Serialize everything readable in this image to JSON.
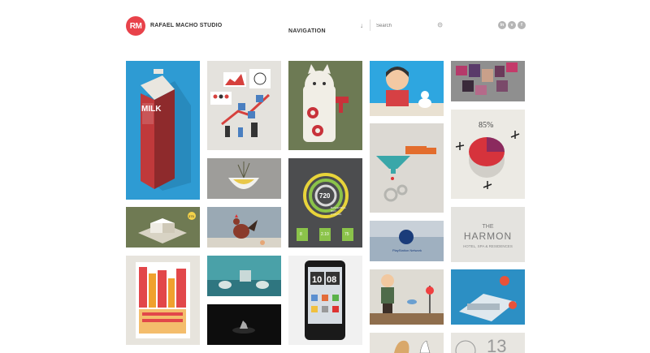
{
  "header": {
    "logo_text": "RM",
    "brand": "RAFAEL MACHO STUDIO",
    "nav_label": "NAVIGATION",
    "search_placeholder": "Search",
    "social": [
      {
        "name": "linkedin-icon",
        "glyph": "in"
      },
      {
        "name": "vimeo-icon",
        "glyph": "v"
      },
      {
        "name": "facebook-icon",
        "glyph": "f"
      }
    ]
  },
  "colors": {
    "accent": "#e8424a",
    "milk_bg": "#2e9bd3",
    "milk_red": "#c0393b"
  },
  "tiles": {
    "milk": {
      "label": "MILK"
    },
    "ring_stats": {
      "big": "720",
      "small": [
        "8",
        "2.10",
        "75"
      ],
      "items": [
        "BASKETBALL",
        "RUN",
        "CYCLING"
      ]
    },
    "phone_clock": {
      "hour": "10",
      "minute": "08"
    },
    "pie": {
      "percent": "85%"
    },
    "harmon": {
      "title": "THE HARMON",
      "subtitle": "HOTEL, SPA & RESIDENCES"
    },
    "playstation": {
      "caption": "PlayStation Network"
    },
    "last": {
      "digits": "13"
    },
    "grid_tag": {
      "tag": "375"
    }
  }
}
